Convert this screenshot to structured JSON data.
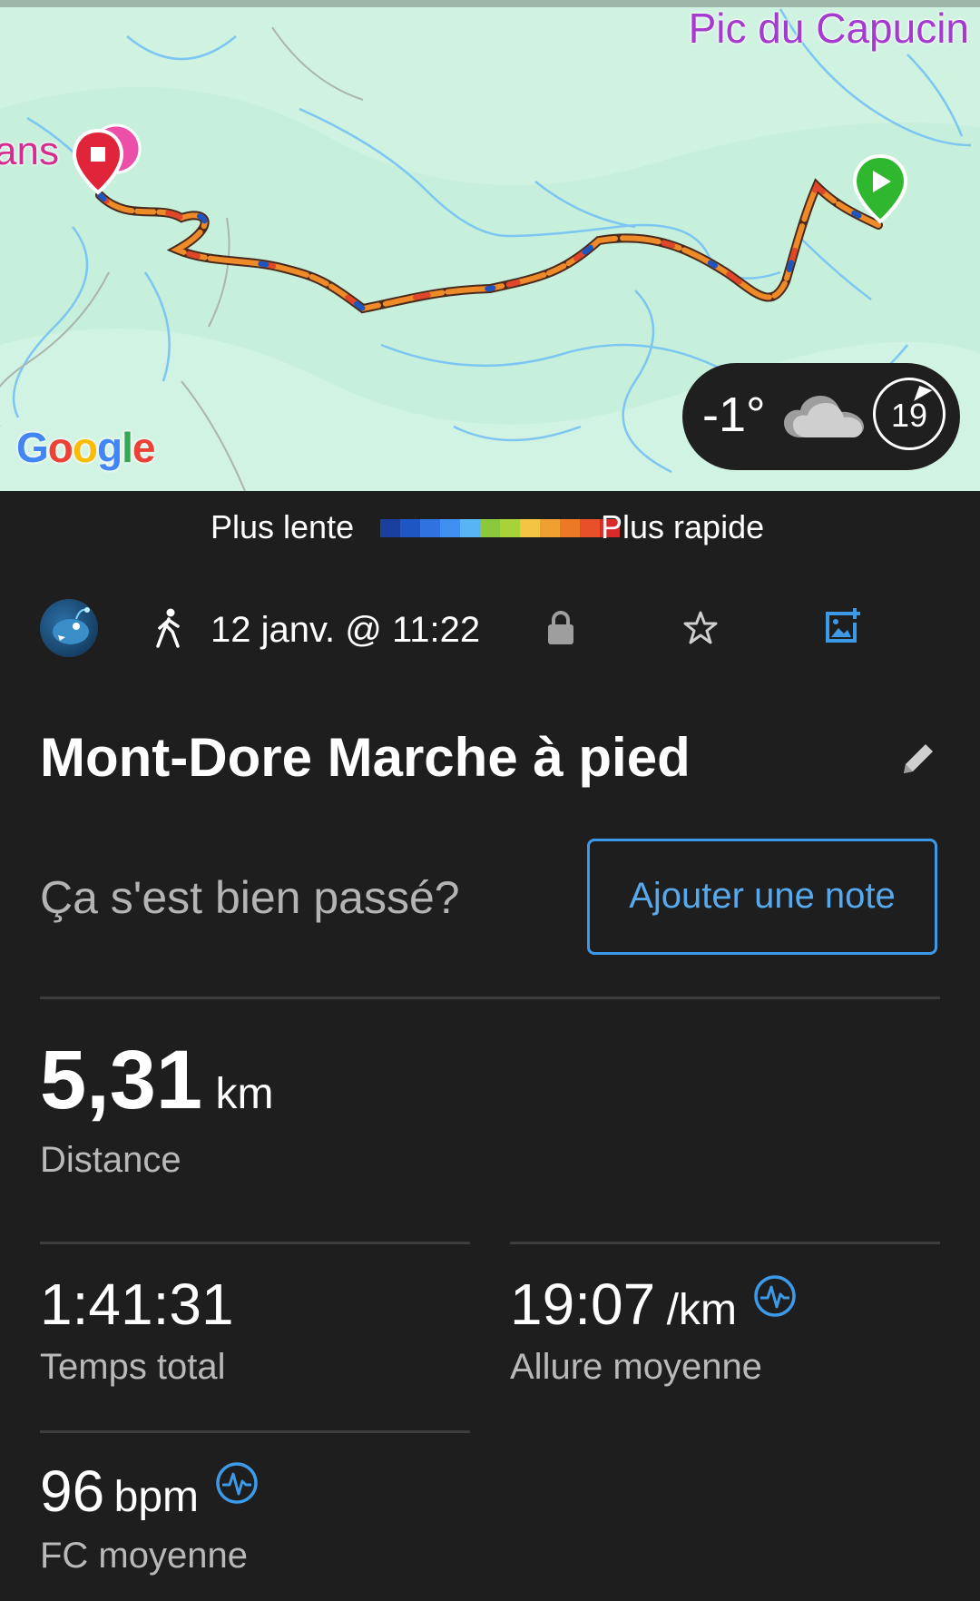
{
  "map": {
    "peak_label": "Pic du Capucin",
    "place_label": "ans",
    "attribution": "Google",
    "weather": {
      "temperature": "-1°",
      "condition_icon": "cloud-icon",
      "wind_badge": "19"
    }
  },
  "legend": {
    "slow_label": "Plus lente",
    "fast_label": "Plus rapide",
    "colors": [
      "#1b3f9c",
      "#1e56c4",
      "#2f73e0",
      "#3f90f0",
      "#59b4f6",
      "#8cc83c",
      "#a8d23a",
      "#f4c542",
      "#f0a030",
      "#ec7a24",
      "#e8502a",
      "#d82a2a"
    ]
  },
  "activity": {
    "avatar_icon": "anglerfish-avatar",
    "type_icon": "walking-icon",
    "datetime": "12 janv. @ 11:22",
    "title": "Mont-Dore Marche à pied",
    "note_prompt": "Ça s'est bien passé?",
    "add_note_label": "Ajouter une note"
  },
  "stats": {
    "distance": {
      "value": "5,31",
      "unit": "km",
      "label": "Distance"
    },
    "total_time": {
      "value": "1:41:31",
      "label": "Temps total"
    },
    "avg_pace": {
      "value": "19:07",
      "unit": "/km",
      "label": "Allure moyenne"
    },
    "avg_hr": {
      "value": "96",
      "unit": "bpm",
      "label": "FC moyenne"
    }
  },
  "colors": {
    "accent_blue": "#3d9ae8",
    "background": "#1e1e1e",
    "map_bg": "#c6efdc"
  }
}
